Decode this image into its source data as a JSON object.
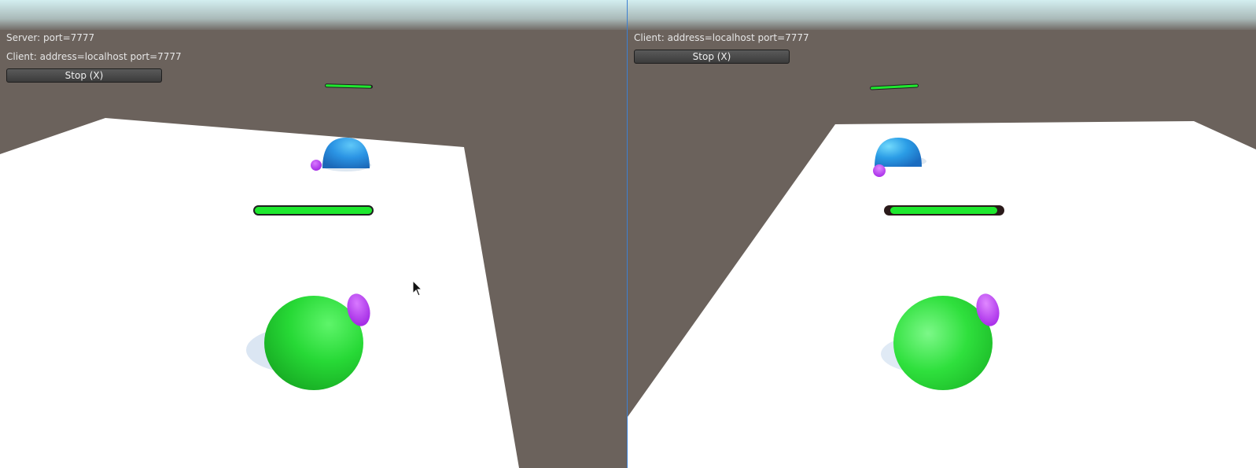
{
  "left_view": {
    "server_label": "Server: port=7777",
    "client_label": "Client: address=localhost port=7777",
    "stop_button": "Stop (X)"
  },
  "right_view": {
    "client_label": "Client: address=localhost port=7777",
    "stop_button": "Stop (X)"
  },
  "colors": {
    "sky": "#d9eef0",
    "ground_wall": "#6b625c",
    "floor": "#ffffff",
    "player": "#22e033",
    "enemy": "#2b94e4",
    "hand": "#b637f0",
    "health_bar": "#1ee82e"
  },
  "health": {
    "left_player": 1.0,
    "left_enemy": 1.0,
    "right_player": 0.9,
    "right_enemy": 1.0
  }
}
